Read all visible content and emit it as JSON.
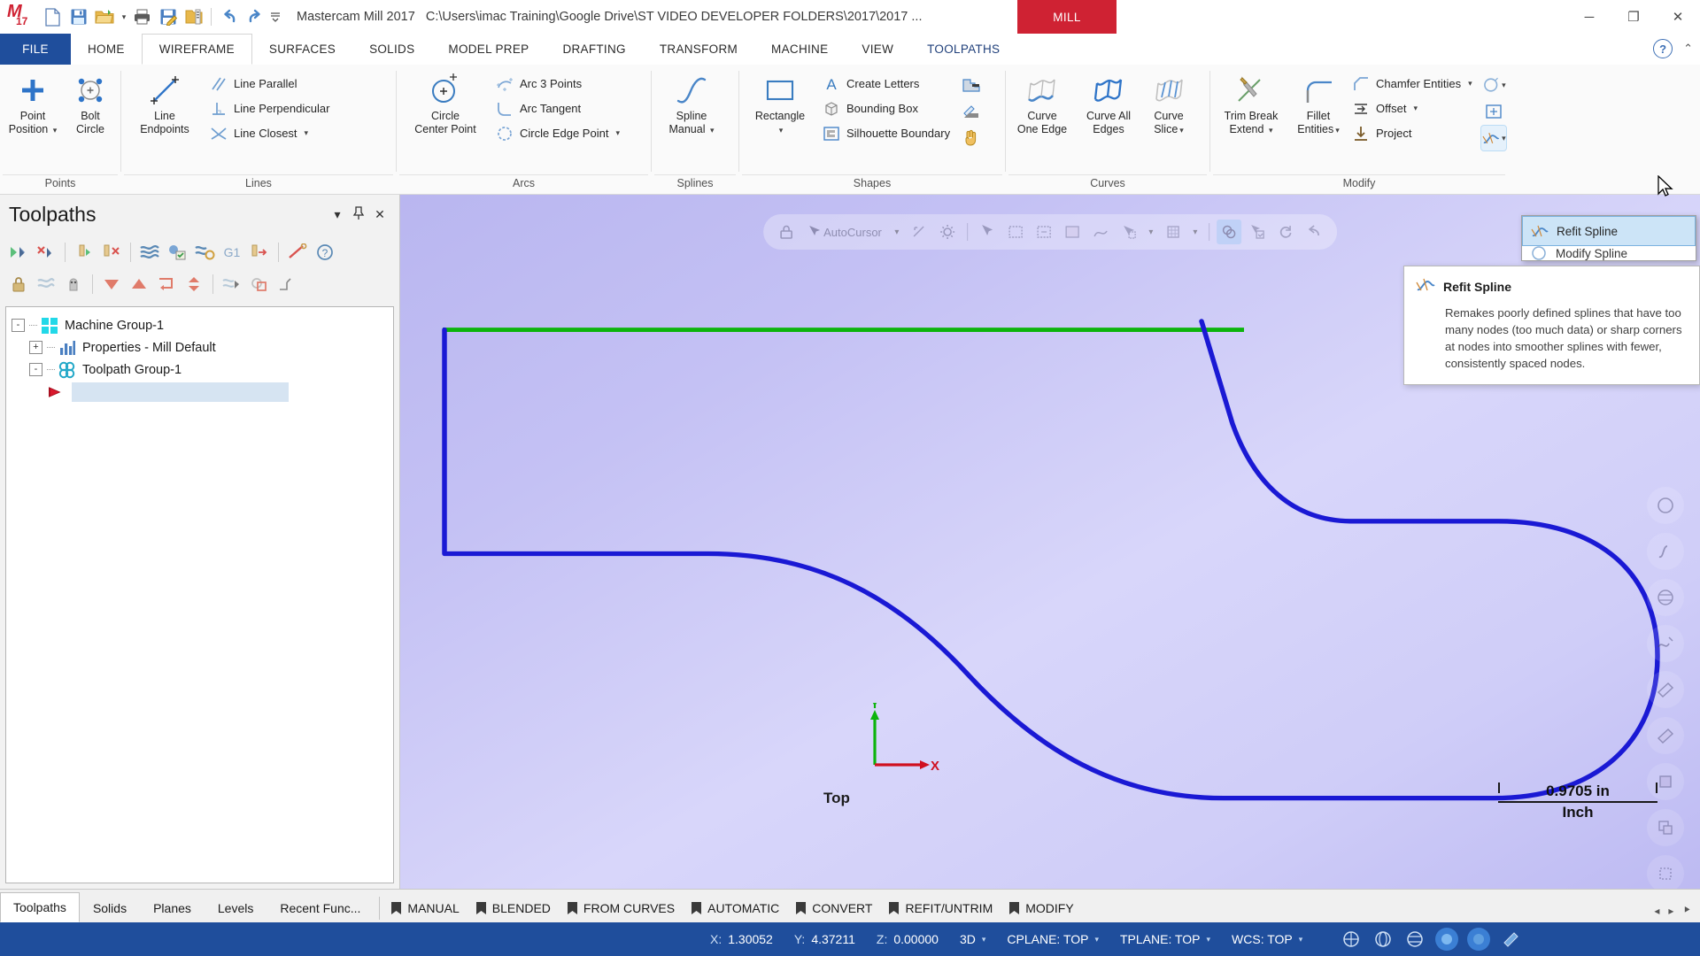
{
  "titlebar": {
    "app_title": "Mastercam Mill 2017",
    "file_path": "C:\\Users\\imac Training\\Google Drive\\ST VIDEO DEVELOPER FOLDERS\\2017\\2017 ...",
    "mill_badge": "MILL",
    "quick_access": [
      {
        "name": "new-file-icon",
        "glyph": "new"
      },
      {
        "name": "save-icon",
        "glyph": "save"
      },
      {
        "name": "open-folder-icon",
        "glyph": "open"
      },
      {
        "name": "open-dropdown-icon",
        "glyph": "caret"
      },
      {
        "name": "print-icon",
        "glyph": "print"
      },
      {
        "name": "save-as-icon",
        "glyph": "saveas"
      },
      {
        "name": "folder-properties-icon",
        "glyph": "folderprops"
      },
      {
        "name": "undo-icon",
        "glyph": "undo"
      },
      {
        "name": "redo-icon",
        "glyph": "redo"
      },
      {
        "name": "customize-qat-icon",
        "glyph": "caretdown"
      }
    ],
    "window_buttons": {
      "minimize": "─",
      "restore": "❐",
      "close": "✕"
    }
  },
  "ribbon_tabs": [
    {
      "label": "FILE",
      "state": "file"
    },
    {
      "label": "HOME",
      "state": "normal"
    },
    {
      "label": "WIREFRAME",
      "state": "active"
    },
    {
      "label": "SURFACES",
      "state": "normal"
    },
    {
      "label": "SOLIDS",
      "state": "normal"
    },
    {
      "label": "MODEL PREP",
      "state": "normal"
    },
    {
      "label": "DRAFTING",
      "state": "normal"
    },
    {
      "label": "TRANSFORM",
      "state": "normal"
    },
    {
      "label": "MACHINE",
      "state": "normal"
    },
    {
      "label": "VIEW",
      "state": "normal"
    },
    {
      "label": "TOOLPATHS",
      "state": "toolpaths"
    }
  ],
  "ribbon_groups": [
    {
      "name": "Points",
      "big_buttons": [
        {
          "label_line1": "Point",
          "label_line2": "Position",
          "icon": "point-position-icon",
          "has_dropdown": true
        },
        {
          "label_line1": "Bolt",
          "label_line2": "Circle",
          "icon": "bolt-circle-icon",
          "has_dropdown": false
        }
      ],
      "small_buttons": []
    },
    {
      "name": "Lines",
      "big_buttons": [
        {
          "label_line1": "Line",
          "label_line2": "Endpoints",
          "icon": "line-endpoints-icon",
          "has_dropdown": false
        }
      ],
      "small_buttons": [
        {
          "label": "Line Parallel",
          "icon": "line-parallel-icon",
          "has_dropdown": false
        },
        {
          "label": "Line Perpendicular",
          "icon": "line-perpendicular-icon",
          "has_dropdown": false
        },
        {
          "label": "Line Closest",
          "icon": "line-closest-icon",
          "has_dropdown": true
        }
      ]
    },
    {
      "name": "Arcs",
      "big_buttons": [
        {
          "label_line1": "Circle",
          "label_line2": "Center Point",
          "icon": "circle-center-point-icon",
          "has_dropdown": false
        }
      ],
      "small_buttons": [
        {
          "label": "Arc 3 Points",
          "icon": "arc-3-points-icon",
          "has_dropdown": false
        },
        {
          "label": "Arc Tangent",
          "icon": "arc-tangent-icon",
          "has_dropdown": false
        },
        {
          "label": "Circle Edge Point",
          "icon": "circle-edge-point-icon",
          "has_dropdown": true
        }
      ]
    },
    {
      "name": "Splines",
      "big_buttons": [
        {
          "label_line1": "Spline",
          "label_line2": "Manual",
          "icon": "spline-manual-icon",
          "has_dropdown": true
        }
      ],
      "small_buttons": []
    },
    {
      "name": "Shapes",
      "big_buttons": [
        {
          "label_line1": "Rectangle",
          "label_line2": "",
          "icon": "rectangle-icon",
          "has_dropdown": true
        }
      ],
      "small_buttons": [
        {
          "label": "Create Letters",
          "icon": "create-letters-icon",
          "has_dropdown": false
        },
        {
          "label": "Bounding Box",
          "icon": "bounding-box-icon",
          "has_dropdown": false
        },
        {
          "label": "Silhouette Boundary",
          "icon": "silhouette-boundary-icon",
          "has_dropdown": false
        }
      ],
      "icon_only": [
        {
          "name": "stair-shape-icon"
        },
        {
          "name": "polygon-shape-icon"
        },
        {
          "name": "hand-shape-icon"
        }
      ]
    },
    {
      "name": "Curves",
      "big_buttons": [
        {
          "label_line1": "Curve",
          "label_line2": "One Edge",
          "icon": "curve-one-edge-icon",
          "has_dropdown": false
        },
        {
          "label_line1": "Curve All",
          "label_line2": "Edges",
          "icon": "curve-all-edges-icon",
          "has_dropdown": false
        },
        {
          "label_line1": "Curve",
          "label_line2": "Slice",
          "icon": "curve-slice-icon",
          "has_dropdown": true
        }
      ],
      "small_buttons": []
    },
    {
      "name": "Modify",
      "big_buttons": [
        {
          "label_line1": "Trim Break",
          "label_line2": "Extend",
          "icon": "trim-break-extend-icon",
          "has_dropdown": true
        },
        {
          "label_line1": "Fillet",
          "label_line2": "Entities",
          "icon": "fillet-entities-icon",
          "has_dropdown": true
        }
      ],
      "small_buttons": [
        {
          "label": "Chamfer Entities",
          "icon": "chamfer-entities-icon",
          "has_dropdown": true
        },
        {
          "label": "Offset",
          "icon": "offset-icon",
          "has_dropdown": true
        },
        {
          "label": "Project",
          "icon": "project-icon",
          "has_dropdown": false
        }
      ],
      "icon_only": [
        {
          "name": "simplify-arc-icon"
        },
        {
          "name": "modify-nurbs-icon"
        },
        {
          "name": "refit-spline-icon"
        }
      ]
    }
  ],
  "refit_menu": {
    "selected": "Refit Spline",
    "second_partial": "Modify Spline"
  },
  "tooltip": {
    "title": "Refit Spline",
    "body": "Remakes poorly defined splines that have too many nodes (too much data) or sharp corners at nodes into smoother splines with fewer, consistently spaced nodes."
  },
  "toolpaths_panel": {
    "title": "Toolpaths",
    "header_actions": [
      {
        "name": "panel-dropdown-icon",
        "glyph": "▾"
      },
      {
        "name": "panel-pin-icon",
        "glyph": "📌"
      },
      {
        "name": "panel-close-icon",
        "glyph": "✕"
      }
    ],
    "toolbar_row1": [
      {
        "name": "select-all-toolpaths-icon"
      },
      {
        "name": "deselect-all-toolpaths-icon"
      },
      {
        "name": "regenerate-selected-icon"
      },
      {
        "name": "regenerate-invalid-icon"
      },
      {
        "name": "backplot-icon"
      },
      {
        "name": "verify-icon"
      },
      {
        "name": "simulate-icon"
      },
      {
        "name": "g1-post-icon",
        "label": "G1"
      },
      {
        "name": "post-selected-icon"
      },
      {
        "name": "high-speed-toolpath-icon"
      },
      {
        "name": "help-toolpaths-icon"
      }
    ],
    "toolbar_row2": [
      {
        "name": "lock-toolpath-icon"
      },
      {
        "name": "toggle-posting-icon"
      },
      {
        "name": "toggle-toolpath-display-icon"
      },
      {
        "name": "move-down-icon"
      },
      {
        "name": "move-up-icon"
      },
      {
        "name": "toggle-tree-icon"
      },
      {
        "name": "expand-collapse-icon"
      },
      {
        "name": "toolpath-filter-icon"
      },
      {
        "name": "copy-toolpath-icon"
      },
      {
        "name": "transform-icon"
      }
    ],
    "tree": [
      {
        "label": "Machine Group-1",
        "level": 0,
        "icon": "machine-group-icon",
        "expander": "-"
      },
      {
        "label": "Properties - Mill Default",
        "level": 1,
        "icon": "properties-icon",
        "expander": "+"
      },
      {
        "label": "Toolpath Group-1",
        "level": 1,
        "icon": "toolpath-group-icon",
        "expander": "-"
      },
      {
        "label": "",
        "level": 2,
        "icon": "insert-arrow-icon",
        "expander": ""
      }
    ]
  },
  "viewport": {
    "autocursor_label": "AutoCursor",
    "view_label": "Top",
    "axis_x": "X",
    "axis_y": "Y",
    "scale_value": "0.9705 in",
    "scale_unit": "Inch",
    "top_toolbar": [
      {
        "name": "lock-autocursor-icon"
      },
      {
        "name": "autocursor-icon"
      },
      {
        "name": "autocursor-dropdown-icon"
      },
      {
        "name": "snap-settings-icon"
      },
      {
        "name": "autocursor-gear-icon"
      },
      {
        "name": "select-cursor-icon"
      },
      {
        "name": "select-window-icon"
      },
      {
        "name": "select-polygon-icon"
      },
      {
        "name": "select-area-icon"
      },
      {
        "name": "select-vector-icon"
      },
      {
        "name": "select-mode-dropdown-icon"
      },
      {
        "name": "select-only-grid-icon"
      },
      {
        "name": "select-only-dropdown-icon"
      },
      {
        "name": "selection-filter-icon"
      },
      {
        "name": "verify-selection-icon"
      },
      {
        "name": "reselect-icon"
      },
      {
        "name": "undo-selection-icon"
      }
    ],
    "right_tools": [
      {
        "name": "fit-view-icon"
      },
      {
        "name": "zoom-window-icon"
      },
      {
        "name": "spline-view-icon"
      },
      {
        "name": "isometric-view-icon"
      },
      {
        "name": "shade-view-icon"
      },
      {
        "name": "wireframe-view-icon"
      },
      {
        "name": "hidden-line-icon"
      },
      {
        "name": "shaded-solid-icon"
      },
      {
        "name": "translucent-icon"
      },
      {
        "name": "material-view-icon"
      }
    ]
  },
  "bottom_tabs": {
    "left": [
      {
        "label": "Toolpaths",
        "active": true
      },
      {
        "label": "Solids",
        "active": false
      },
      {
        "label": "Planes",
        "active": false
      },
      {
        "label": "Levels",
        "active": false
      },
      {
        "label": "Recent Func...",
        "active": false
      }
    ],
    "flags": [
      {
        "label": "MANUAL"
      },
      {
        "label": "BLENDED"
      },
      {
        "label": "FROM CURVES"
      },
      {
        "label": "AUTOMATIC"
      },
      {
        "label": "CONVERT"
      },
      {
        "label": "REFIT/UNTRIM"
      },
      {
        "label": "MODIFY"
      }
    ],
    "nav": [
      "◂",
      "▸",
      "⯈"
    ]
  },
  "status_bar": {
    "x_label": "X:",
    "x_value": "1.30052",
    "y_label": "Y:",
    "y_value": "4.37211",
    "z_label": "Z:",
    "z_value": "0.00000",
    "mode": "3D",
    "cplane": "CPLANE: TOP",
    "tplane": "TPLANE: TOP",
    "wcs": "WCS: TOP",
    "right_icons": [
      {
        "name": "gview-icon"
      },
      {
        "name": "wcs-globe-icon"
      },
      {
        "name": "plane-globe-icon"
      },
      {
        "name": "shade-toggle-icon"
      },
      {
        "name": "wireframe-toggle-icon"
      },
      {
        "name": "translucency-toggle-icon"
      }
    ]
  },
  "colors": {
    "accent_blue": "#1f4e9c",
    "mill_red": "#cf2233",
    "geometry_blue": "#1a19d4",
    "geometry_green": "#10b010",
    "viewport_bg": "#c6c3f6"
  }
}
